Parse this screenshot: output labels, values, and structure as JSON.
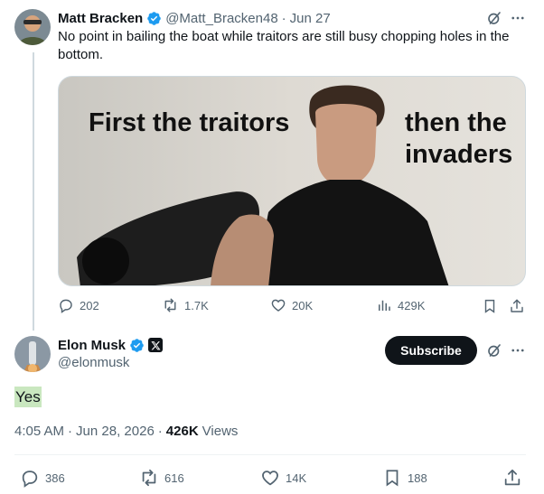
{
  "parent_tweet": {
    "name": "Matt Bracken",
    "handle": "@Matt_Bracken48",
    "separator": "·",
    "date": "Jun 27",
    "text": "No point in bailing the boat while traitors are still busy chopping holes in the bottom.",
    "media": {
      "caption_left": "First the traitors",
      "caption_right_line1": "then the",
      "caption_right_line2": "invaders"
    },
    "actions": {
      "replies": "202",
      "reposts": "1.7K",
      "likes": "20K",
      "views": "429K"
    }
  },
  "main_tweet": {
    "name": "Elon Musk",
    "handle": "@elonmusk",
    "subscribe_label": "Subscribe",
    "text": "Yes",
    "time": "4:05 AM",
    "separator1": "·",
    "date": "Jun 28, 2026",
    "separator2": "·",
    "views_count": "426K",
    "views_label": "Views",
    "actions": {
      "replies": "386",
      "reposts": "616",
      "likes": "14K",
      "bookmarks": "188"
    }
  },
  "colors": {
    "text": "#0f1419",
    "secondary": "#536471",
    "verified": "#1d9bf0",
    "highlight": "#c9e7bf"
  }
}
